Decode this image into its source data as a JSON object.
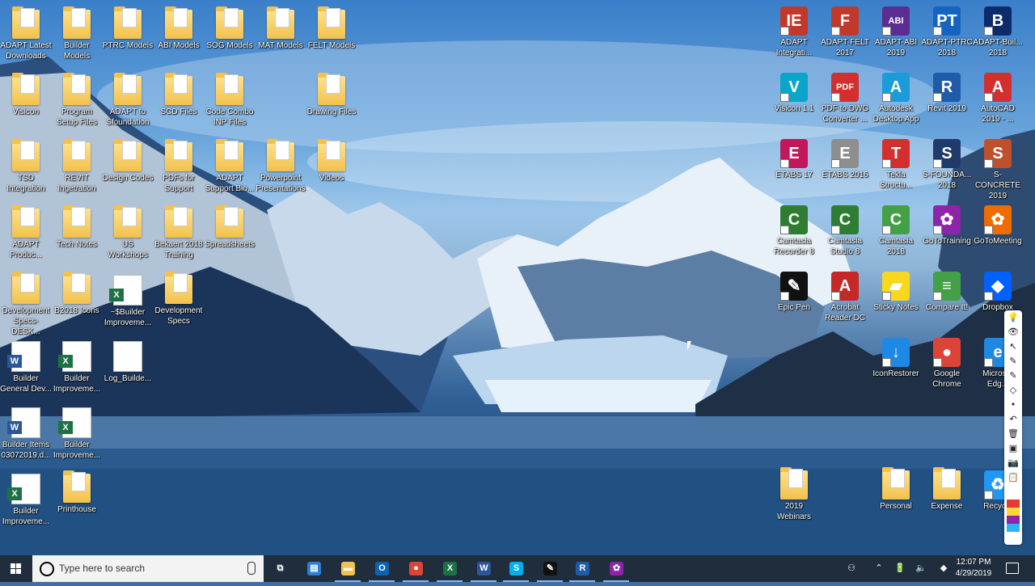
{
  "desktop": {
    "icons": [
      {
        "label": "ADAPT Latest Downloads",
        "kind": "folder"
      },
      {
        "label": "Builder Models",
        "kind": "folder"
      },
      {
        "label": "PTRC Models",
        "kind": "folder"
      },
      {
        "label": "ABI Models",
        "kind": "folder"
      },
      {
        "label": "SOG Models",
        "kind": "folder"
      },
      {
        "label": "MAT Models",
        "kind": "folder"
      },
      {
        "label": "FELT Models",
        "kind": "folder"
      },
      {
        "label": "Visicon",
        "kind": "folder"
      },
      {
        "label": "Program Setup Files",
        "kind": "folder"
      },
      {
        "label": "ADAPT to Sfoundation",
        "kind": "folder"
      },
      {
        "label": "SCD Files",
        "kind": "folder"
      },
      {
        "label": "Code Combo INP Files",
        "kind": "folder"
      },
      {
        "label": "Drawing Files",
        "kind": "folder"
      },
      {
        "label": "TSD Integration",
        "kind": "folder"
      },
      {
        "label": "REVIT Ingetration",
        "kind": "folder"
      },
      {
        "label": "Design Codes",
        "kind": "folder"
      },
      {
        "label": "PDFs for Support",
        "kind": "folder"
      },
      {
        "label": "ADAPT Support Bio...",
        "kind": "folder"
      },
      {
        "label": "Powerpoint Presentations",
        "kind": "folder"
      },
      {
        "label": "Videos",
        "kind": "folder"
      },
      {
        "label": "ADAPT Produc...",
        "kind": "folder"
      },
      {
        "label": "Tech Notes",
        "kind": "folder"
      },
      {
        "label": "US Workshops",
        "kind": "folder"
      },
      {
        "label": "Bekaert 2018 Training",
        "kind": "folder"
      },
      {
        "label": "Spreadsheets",
        "kind": "folder"
      },
      {
        "label": "Development Specs-DESK...",
        "kind": "folder"
      },
      {
        "label": "B2018 Icons",
        "kind": "folder"
      },
      {
        "label": "~$Builder Improveme...",
        "kind": "excel"
      },
      {
        "label": "Development Specs",
        "kind": "folder"
      },
      {
        "label": "Builder General Dev...",
        "kind": "word"
      },
      {
        "label": "Builder Improveme...",
        "kind": "excel"
      },
      {
        "label": "Log_Builde...",
        "kind": "file"
      },
      {
        "label": "Builder Items 03072019.d...",
        "kind": "word"
      },
      {
        "label": "Builder Improveme...",
        "kind": "excel"
      },
      {
        "label": "Builder Improveme...",
        "kind": "excel"
      },
      {
        "label": "Printhouse",
        "kind": "folder"
      },
      {
        "label": "ADAPT Integrati...",
        "kind": "app",
        "glyph": "IE",
        "color": "#c0392b"
      },
      {
        "label": "ADAPT-FELT 2017",
        "kind": "app",
        "glyph": "F",
        "color": "#c0392b"
      },
      {
        "label": "ADAPT-ABI 2019",
        "kind": "app",
        "glyph": "ABI",
        "color": "#5b2c91"
      },
      {
        "label": "ADAPT-PTRC 2018",
        "kind": "app",
        "glyph": "PT",
        "color": "#1565c0"
      },
      {
        "label": "ADAPT-Buil... 2018",
        "kind": "app",
        "glyph": "B",
        "color": "#0d2b6b"
      },
      {
        "label": "Visicon 1.1",
        "kind": "app",
        "glyph": "V",
        "color": "#0aa5c9"
      },
      {
        "label": "PDF to DWG Converter ...",
        "kind": "app",
        "glyph": "PDF",
        "color": "#d32f2f"
      },
      {
        "label": "Autodesk Desktop App",
        "kind": "app",
        "glyph": "A",
        "color": "#1b9bd7"
      },
      {
        "label": "Revit 2019",
        "kind": "app",
        "glyph": "R",
        "color": "#1f5ba8"
      },
      {
        "label": "AutoCAD 2019 - ...",
        "kind": "app",
        "glyph": "A",
        "color": "#d32f2f"
      },
      {
        "label": "ETABS 17",
        "kind": "app",
        "glyph": "E",
        "color": "#c2185b"
      },
      {
        "label": "ETABS 2016",
        "kind": "app",
        "glyph": "E",
        "color": "#8e8e8e"
      },
      {
        "label": "Tekla Structu...",
        "kind": "app",
        "glyph": "T",
        "color": "#d32f2f"
      },
      {
        "label": "S-FOUNDA... 2018",
        "kind": "app",
        "glyph": "S",
        "color": "#1f3a6b"
      },
      {
        "label": "S-CONCRETE 2019",
        "kind": "app",
        "glyph": "S",
        "color": "#c0502b"
      },
      {
        "label": "Camtasia Recorder 8",
        "kind": "app",
        "glyph": "C",
        "color": "#2e7d32"
      },
      {
        "label": "Camtasia Studio 8",
        "kind": "app",
        "glyph": "C",
        "color": "#2e7d32"
      },
      {
        "label": "Camtasia 2018",
        "kind": "app",
        "glyph": "C",
        "color": "#43a047"
      },
      {
        "label": "GoToTraining",
        "kind": "app",
        "glyph": "✿",
        "color": "#8e24aa"
      },
      {
        "label": "GoToMeeting",
        "kind": "app",
        "glyph": "✿",
        "color": "#ef6c00"
      },
      {
        "label": "Epic Pen",
        "kind": "app",
        "glyph": "✎",
        "color": "#111111"
      },
      {
        "label": "Acrobat Reader DC",
        "kind": "app",
        "glyph": "A",
        "color": "#c62828"
      },
      {
        "label": "Sticky Notes",
        "kind": "app",
        "glyph": "▰",
        "color": "#f9d71c"
      },
      {
        "label": "Compare It!",
        "kind": "app",
        "glyph": "≡",
        "color": "#43a047"
      },
      {
        "label": "Dropbox",
        "kind": "app",
        "glyph": "◆",
        "color": "#0061ff"
      },
      {
        "label": "IconRestorer",
        "kind": "app",
        "glyph": "↓",
        "color": "#1e88e5"
      },
      {
        "label": "Google Chrome",
        "kind": "app",
        "glyph": "●",
        "color": "#db4437"
      },
      {
        "label": "Micros... Edg...",
        "kind": "app",
        "glyph": "e",
        "color": "#1e88e5"
      },
      {
        "label": "2019 Webinars",
        "kind": "folder"
      },
      {
        "label": "Personal",
        "kind": "folder"
      },
      {
        "label": "Expense",
        "kind": "folder"
      },
      {
        "label": "Recycle",
        "kind": "app",
        "glyph": "♻",
        "color": "#2196f3"
      }
    ]
  },
  "pen_toolbar": {
    "tools": [
      "💡",
      "👁",
      "↖",
      "✎",
      "✎",
      "◇",
      "•",
      "↶",
      "🗑",
      "▣",
      "📷",
      "📋"
    ]
  },
  "taskbar": {
    "search_placeholder": "Type here to search",
    "pinned": [
      {
        "name": "task-view",
        "glyph": "⧉",
        "color": "#1f2d3d"
      },
      {
        "name": "store",
        "glyph": "▤",
        "color": "#2a7fd4"
      },
      {
        "name": "file-explorer",
        "glyph": "▬",
        "color": "#f2c14e"
      },
      {
        "name": "outlook",
        "glyph": "O",
        "color": "#0a64b3"
      },
      {
        "name": "chrome",
        "glyph": "●",
        "color": "#db4437"
      },
      {
        "name": "excel",
        "glyph": "X",
        "color": "#1e7145"
      },
      {
        "name": "word",
        "glyph": "W",
        "color": "#2b579a"
      },
      {
        "name": "skype",
        "glyph": "S",
        "color": "#00aff0"
      },
      {
        "name": "epic-pen",
        "glyph": "✎",
        "color": "#111111"
      },
      {
        "name": "revit",
        "glyph": "R",
        "color": "#1f5ba8"
      },
      {
        "name": "gototraining",
        "glyph": "✿",
        "color": "#8e24aa"
      }
    ],
    "tray": [
      "⚇",
      "⌃",
      "🔋",
      "🔈",
      "◆"
    ],
    "time": "12:07 PM",
    "date": "4/29/2019"
  }
}
